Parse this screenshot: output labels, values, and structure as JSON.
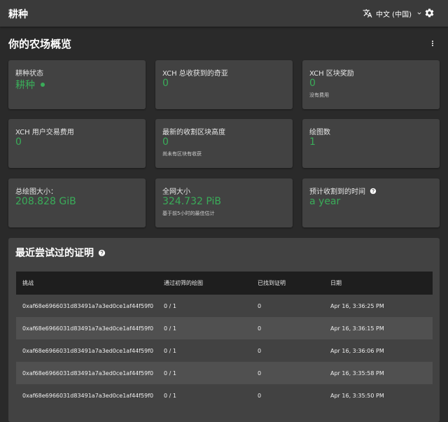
{
  "appbar": {
    "title": "耕种",
    "language": "中文 (中国)"
  },
  "overview": {
    "title": "你的农场概览",
    "cards": [
      {
        "label": "耕种状态",
        "value": "耕种",
        "sub": ""
      },
      {
        "label": "XCH 总收获到的奇亚",
        "value": "0",
        "sub": ""
      },
      {
        "label": "XCH 区块奖励",
        "value": "0",
        "sub": "没有费用"
      },
      {
        "label": "XCH 用户交易费用",
        "value": "0",
        "sub": ""
      },
      {
        "label": "最新的收割区块高度",
        "value": "0",
        "sub": "尚未有区块有收获"
      },
      {
        "label": "绘图数",
        "value": "1",
        "sub": ""
      },
      {
        "label": "总绘图大小：",
        "value": "208.828 GiB",
        "sub": ""
      },
      {
        "label": "全网大小",
        "value": "324.732 PiB",
        "sub": "基于前5小时的最佳估计"
      },
      {
        "label": "预计收割到的时间",
        "value": "a year",
        "sub": ""
      }
    ]
  },
  "proofs": {
    "title": "最近尝试过的证明",
    "columns": [
      "挑战",
      "通过初筛的绘图",
      "已找到证明",
      "日期"
    ],
    "rows": [
      {
        "challenge": "0xaf68e6966031d83491a7a3ed0ce1af44f59f0",
        "plots": "0 / 1",
        "found": "0",
        "date": "Apr 16, 3:36:25 PM"
      },
      {
        "challenge": "0xaf68e6966031d83491a7a3ed0ce1af44f59f0",
        "plots": "0 / 1",
        "found": "0",
        "date": "Apr 16, 3:36:15 PM"
      },
      {
        "challenge": "0xaf68e6966031d83491a7a3ed0ce1af44f59f0",
        "plots": "0 / 1",
        "found": "0",
        "date": "Apr 16, 3:36:06 PM"
      },
      {
        "challenge": "0xaf68e6966031d83491a7a3ed0ce1af44f59f0",
        "plots": "0 / 1",
        "found": "0",
        "date": "Apr 16, 3:35:58 PM"
      },
      {
        "challenge": "0xaf68e6966031d83491a7a3ed0ce1af44f59f0",
        "plots": "0 / 1",
        "found": "0",
        "date": "Apr 16, 3:35:50 PM"
      }
    ]
  },
  "colors": {
    "accent_green": "#3aac59",
    "background": "#2a2a2a",
    "appbar": "#3a3a3a",
    "card": "#424242",
    "table_header": "#1e1e1e"
  },
  "icons": {
    "language": "translate-icon",
    "dropdown": "chevron-down-icon",
    "settings": "gear-icon",
    "menu": "more-vert-icon",
    "help": "help-circle-icon",
    "status": "status-dot-icon"
  }
}
